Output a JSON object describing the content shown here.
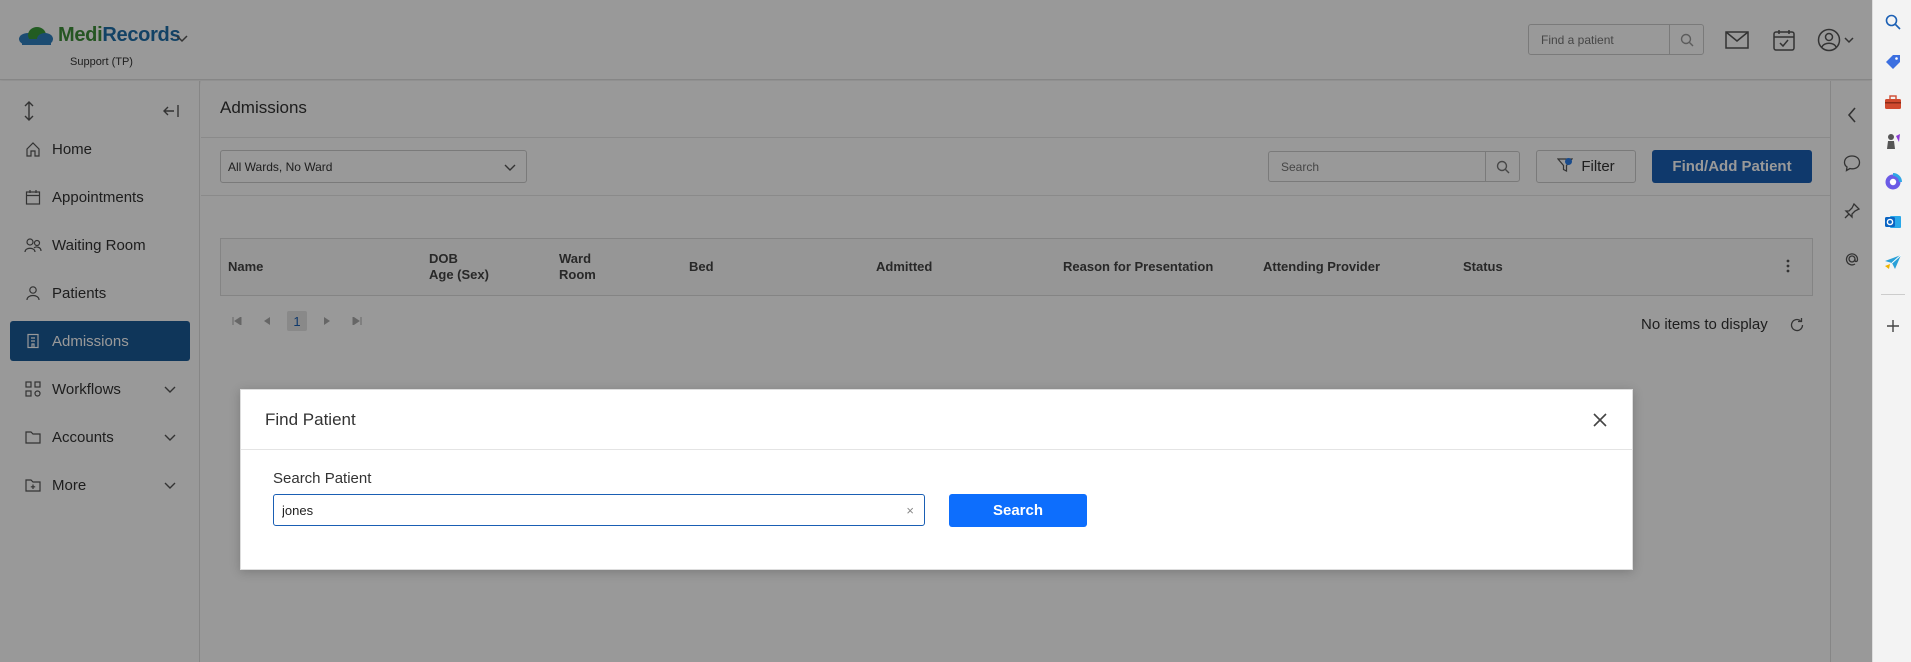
{
  "header": {
    "logo_text_a": "Medi",
    "logo_text_b": "Records",
    "org": "Support (TP)",
    "search_placeholder": "Find a patient"
  },
  "sidebar": {
    "items": [
      {
        "label": "Home",
        "icon": "home-icon"
      },
      {
        "label": "Appointments",
        "icon": "calendar-icon"
      },
      {
        "label": "Waiting Room",
        "icon": "people-icon"
      },
      {
        "label": "Patients",
        "icon": "person-icon"
      },
      {
        "label": "Admissions",
        "icon": "building-icon",
        "active": true
      },
      {
        "label": "Workflows",
        "icon": "workflow-icon",
        "expandable": true
      },
      {
        "label": "Accounts",
        "icon": "folder-icon",
        "expandable": true
      },
      {
        "label": "More",
        "icon": "folder-plus-icon",
        "expandable": true
      }
    ]
  },
  "main": {
    "title": "Admissions",
    "ward_select": "All Wards, No Ward",
    "search_placeholder": "Search",
    "filter_label": "Filter",
    "find_add_label": "Find/Add Patient",
    "columns": {
      "name": "Name",
      "dob_1": "DOB",
      "dob_2": "Age (Sex)",
      "ward_1": "Ward",
      "ward_2": "Room",
      "bed": "Bed",
      "admitted": "Admitted",
      "reason": "Reason for Presentation",
      "provider": "Attending Provider",
      "status": "Status"
    },
    "pager": {
      "current_page": "1"
    },
    "empty_text": "No items to display"
  },
  "modal": {
    "title": "Find Patient",
    "label": "Search Patient",
    "input_value": "jones",
    "clear_glyph": "×",
    "search_button": "Search"
  },
  "colors": {
    "brand_blue": "#1a5fb4",
    "active_nav": "#1a5a96",
    "modal_button": "#0d6efd",
    "overlay": "rgba(0,0,0,0.4)"
  }
}
